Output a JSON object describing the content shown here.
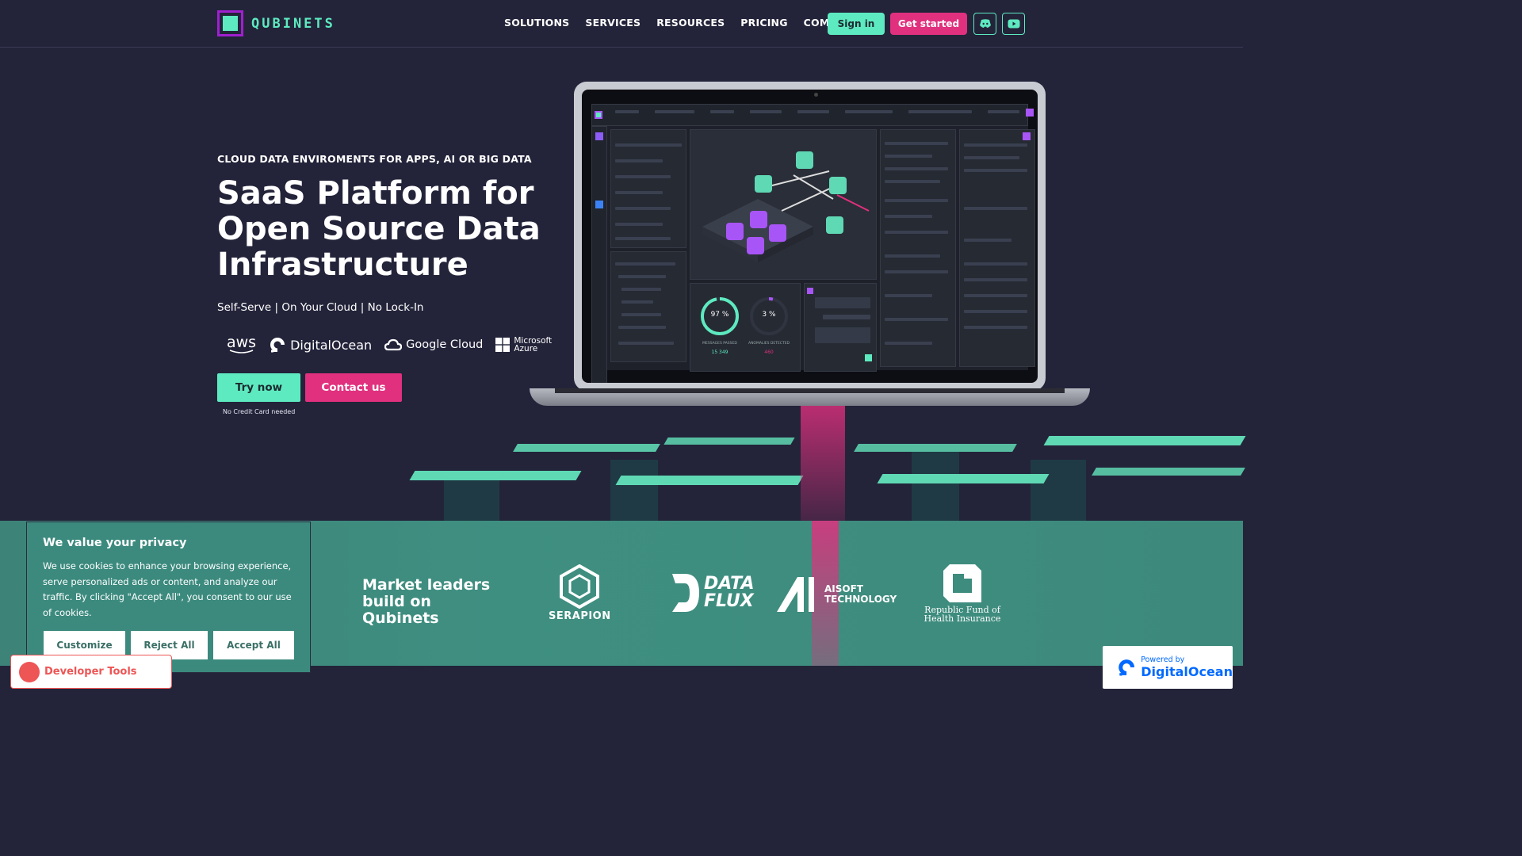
{
  "header": {
    "logo_text": "QUBINETS",
    "nav": [
      "SOLUTIONS",
      "SERVICES",
      "RESOURCES",
      "PRICING",
      "COMPANY"
    ],
    "sign_in": "Sign in",
    "get_started": "Get started",
    "icons": [
      "discord-icon",
      "youtube-icon"
    ]
  },
  "hero": {
    "eyebrow": "CLOUD DATA ENVIROMENTS FOR APPS, AI OR BIG DATA",
    "title": "SaaS Platform for Open Source Data Infrastructure",
    "subtitle": "Self-Serve | On Your Cloud | No Lock-In",
    "clouds": [
      "aws",
      "DigitalOcean",
      "Google Cloud",
      "Microsoft Azure"
    ],
    "try_now": "Try now",
    "contact_us": "Contact us",
    "note": "No Credit Card needed"
  },
  "dashboard": {
    "gauge_left": "97 %",
    "gauge_left_label": "MESSAGES PASSED",
    "gauge_left_value": "15 349",
    "gauge_right": "3 %",
    "gauge_right_label": "ANOMALIES DETECTED",
    "gauge_right_value": "460"
  },
  "partners": {
    "heading": "Market leaders build on Qubinets",
    "logos": [
      {
        "name": "SERAPION"
      },
      {
        "name": "DATA FLUX"
      },
      {
        "name": "AISOFT TECHNOLOGY"
      },
      {
        "name": "Republic Fund of Health Insurance"
      }
    ]
  },
  "cookie": {
    "title": "We value your privacy",
    "text": "We use cookies to enhance your browsing experience, serve personalized ads or content, and analyze our traffic. By clicking \"Accept All\", you consent to our use of cookies.",
    "customize": "Customize",
    "reject_all": "Reject All",
    "accept_all": "Accept All"
  },
  "devtools_label": "Developer Tools",
  "powered_by": {
    "small": "Powered by",
    "big": "DigitalOcean"
  },
  "colors": {
    "background": "#23243a",
    "accent_teal": "#5eeac0",
    "accent_pink": "#e0307e",
    "band": "#3c8a7e"
  }
}
